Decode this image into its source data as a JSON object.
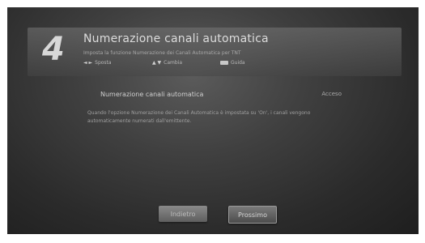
{
  "header": {
    "step_number": "4",
    "title": "Numerazione canali automatica",
    "subtitle": "Imposta la funzione Numerazione dei Canali Automatica per TNT"
  },
  "legend": [
    {
      "symbol": "◄ ►",
      "label": "Sposta"
    },
    {
      "symbol": "▲ ▼",
      "label": "Cambia"
    },
    {
      "symbol": "",
      "label": "Guida"
    }
  ],
  "setting": {
    "label": "Numerazione canali automatica",
    "value": "Acceso"
  },
  "description": "Quando l'opzione Numerazione dei Canali Automatica è impostata su 'On', i canali vengono automaticamente numerati dall'emittente.",
  "buttons": {
    "back_label": "Indietro",
    "next_label": "Prossimo"
  }
}
